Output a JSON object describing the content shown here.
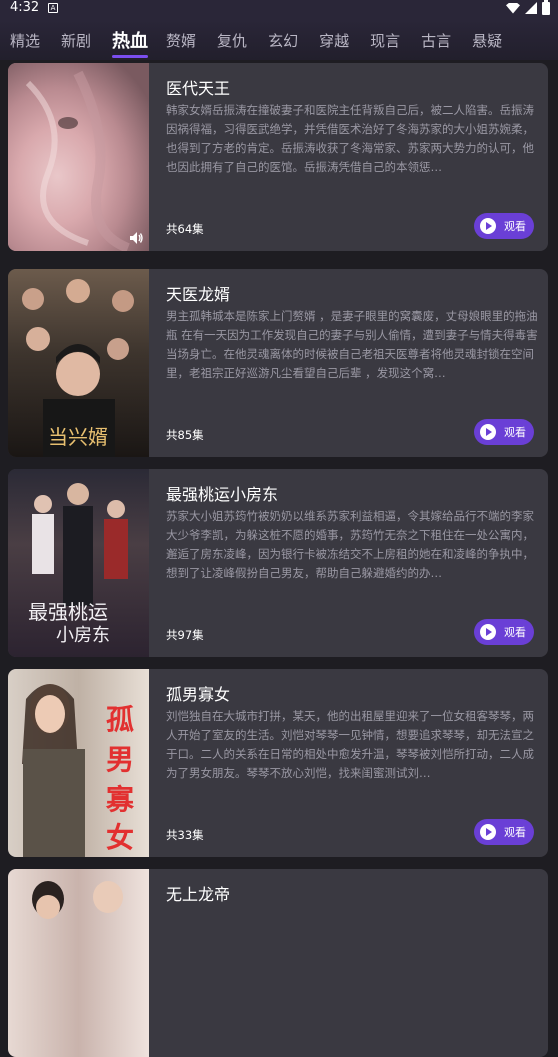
{
  "status": {
    "time": "4:32",
    "notification": "A"
  },
  "tabs": [
    "精选",
    "新剧",
    "热血",
    "赘婿",
    "复仇",
    "玄幻",
    "穿越",
    "现言",
    "古言",
    "悬疑"
  ],
  "active_tab": "热血",
  "watch_label": "观看",
  "dramas": [
    {
      "title": "医代天王",
      "description": "韩家女婿岳振涛在撞破妻子和医院主任背叛自己后，被二人陷害。岳振涛因祸得福，习得医武绝学，并凭借医术治好了冬海苏家的大小姐苏婉柔，也得到了方老的肯定。岳振涛收获了冬海常家、苏家两大势力的认可，他也因此拥有了自己的医馆。岳振涛凭借自己的本领惩…",
      "episodes": "共64集"
    },
    {
      "title": "天医龙婿",
      "description": "男主孤韩城本是陈家上门赘婿 ，是妻子眼里的窝囊废，丈母娘眼里的拖油瓶 在有一天因为工作发现自己的妻子与别人偷情，遭到妻子与情夫得毒害当场身亡。在他灵魂离体的时候被自己老祖天医尊者将他灵魂封锁在空间里，老祖宗正好巡游凡尘看望自己后辈 ，发现这个窝…",
      "episodes": "共85集"
    },
    {
      "title": "最强桃运小房东",
      "description": "苏家大小姐苏筠竹被奶奶以维系苏家利益相逼，令其嫁给品行不端的李家大少爷李凯，为躲这桩不愿的婚事，苏筠竹无奈之下租住在一处公寓内，邂逅了房东凌峰，因为银行卡被冻结交不上房租的她在和凌峰的争执中，想到了让凌峰假扮自己男友，帮助自己躲避婚约的办…",
      "episodes": "共97集"
    },
    {
      "title": "孤男寡女",
      "description": "刘恺独自在大城市打拼，某天，他的出租屋里迎来了一位女租客琴琴，两人开始了室友的生活。刘恺对琴琴一见钟情，想要追求琴琴，却无法宣之于口。二人的关系在日常的相处中愈发升温，琴琴被刘恺所打动，二人成为了男女朋友。琴琴不放心刘恺，找来闺蜜测试刘…",
      "episodes": "共33集"
    },
    {
      "title": "无上龙帝",
      "description": "",
      "episodes": ""
    }
  ],
  "colors": {
    "background": "#1e1d22",
    "card": "#3a3941",
    "accent": "#6a3fd6",
    "tab_indicator": "#7b4ef0"
  }
}
